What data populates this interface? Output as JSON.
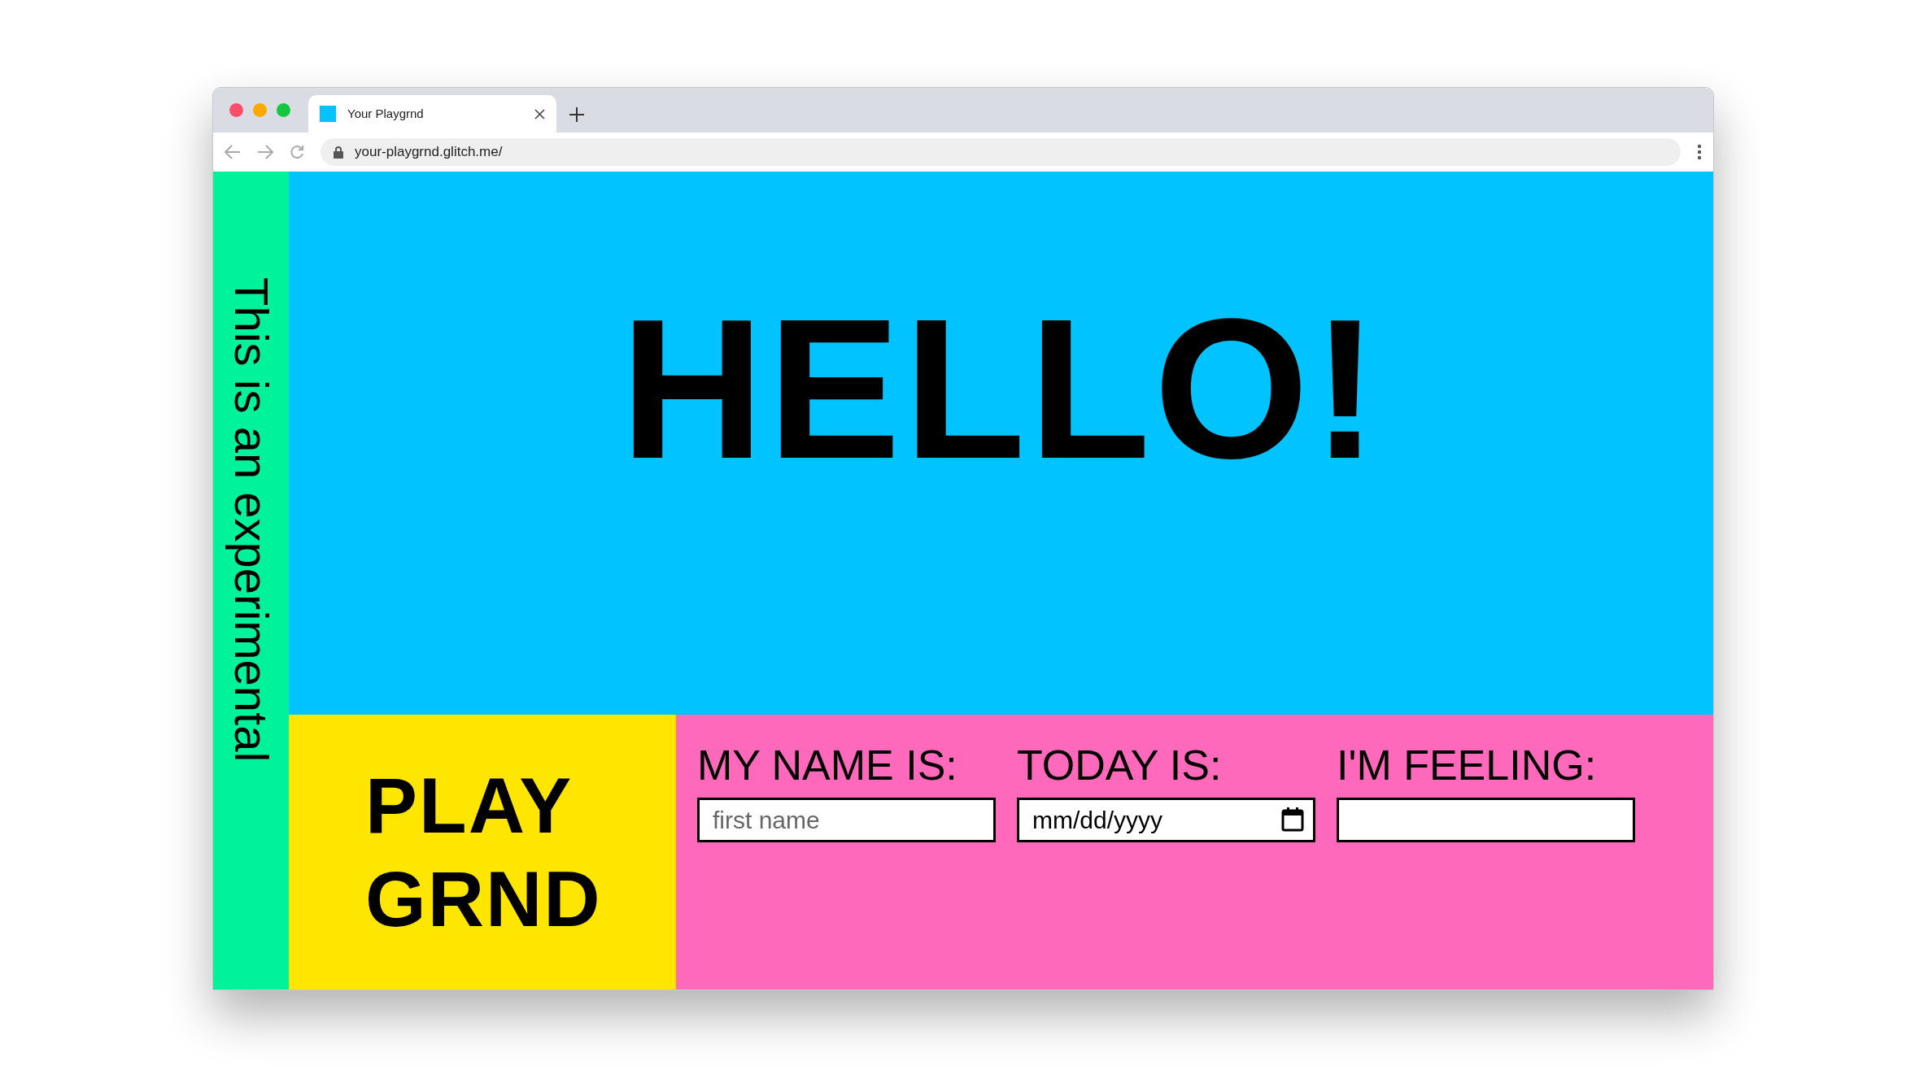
{
  "browser": {
    "tabs": [
      {
        "title": "Your Playgrnd",
        "selected": true
      }
    ],
    "url": "your-playgrnd.glitch.me/"
  },
  "sidebar": {
    "text": "This is an experimental"
  },
  "hero": {
    "title": "HELLO!"
  },
  "logo": {
    "lines": [
      "PLAY",
      "GRND"
    ]
  },
  "form": {
    "fields": [
      {
        "label": "MY NAME IS:",
        "kind": "text",
        "placeholder": "first name"
      },
      {
        "label": "TODAY IS:",
        "kind": "date",
        "value": "mm/dd/yyyy"
      },
      {
        "label": "I'M FEELING:",
        "kind": "text"
      }
    ]
  }
}
